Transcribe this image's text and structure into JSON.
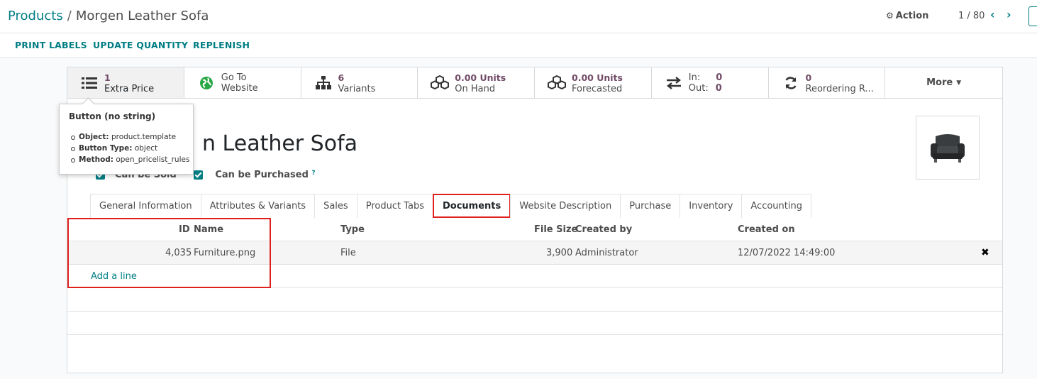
{
  "breadcrumb": {
    "parent": "Products",
    "separator": "/",
    "current": "Morgen Leather Sofa"
  },
  "header": {
    "action_label": "Action",
    "pager": "1 / 80"
  },
  "control_buttons": [
    "PRINT LABELS",
    "UPDATE QUANTITY",
    "REPLENISH"
  ],
  "smart_buttons": [
    {
      "icon": "list-icon",
      "value": "1",
      "label": "Extra Price"
    },
    {
      "icon": "globe-icon",
      "value": "Go To",
      "label": "Website"
    },
    {
      "icon": "sitemap-icon",
      "value": "6",
      "label": "Variants"
    },
    {
      "icon": "cubes-icon",
      "value": "0.00 Units",
      "label": "On Hand"
    },
    {
      "icon": "cubes-icon",
      "value": "0.00 Units",
      "label": "Forecasted"
    },
    {
      "icon": "exchange-icon",
      "in_label": "In:",
      "in_value": "0",
      "out_label": "Out:",
      "out_value": "0"
    },
    {
      "icon": "refresh-icon",
      "value": "0",
      "label": "Reordering R..."
    },
    {
      "label": "More"
    }
  ],
  "product": {
    "title_visible": "n Leather Sofa",
    "can_be_sold": "Can be Sold",
    "can_be_purchased": "Can be Purchased",
    "help_mark": "?"
  },
  "tabs": [
    "General Information",
    "Attributes & Variants",
    "Sales",
    "Product Tabs",
    "Documents",
    "Website Description",
    "Purchase",
    "Inventory",
    "Accounting"
  ],
  "active_tab": "Documents",
  "documents": {
    "columns": {
      "id": "ID",
      "name": "Name",
      "type": "Type",
      "file_size": "File Size",
      "created_by": "Created by",
      "created_on": "Created on"
    },
    "rows": [
      {
        "id": "4,035",
        "name": "Furniture.png",
        "type": "File",
        "file_size": "3,900",
        "created_by": "Administrator",
        "created_on": "12/07/2022 14:49:00"
      }
    ],
    "add_line": "Add a line",
    "delete_glyph": "✖"
  },
  "tooltip": {
    "title": "Button (no string)",
    "items": [
      {
        "key": "Object:",
        "value": "product.template"
      },
      {
        "key": "Button Type:",
        "value": "object"
      },
      {
        "key": "Method:",
        "value": "open_pricelist_rules"
      }
    ]
  },
  "colors": {
    "accent": "#017e84",
    "stat_value": "#714b67",
    "highlight": "#e01f1f"
  }
}
